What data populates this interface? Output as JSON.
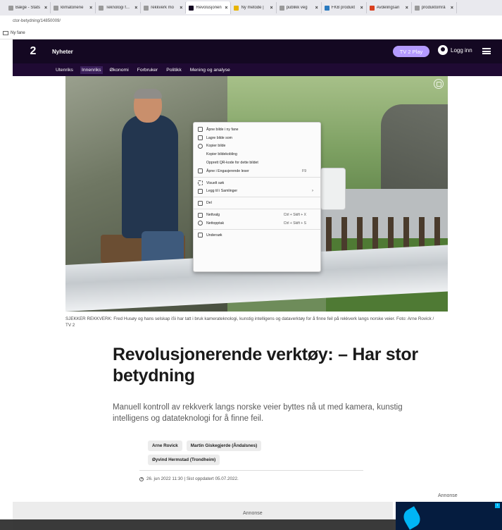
{
  "browser": {
    "tabs": [
      {
        "label": "Bæge - Stats"
      },
      {
        "label": "klimatoriene"
      },
      {
        "label": "Teknologi f..."
      },
      {
        "label": "rekkverk mo"
      },
      {
        "label": "Revolusjonen",
        "active": true
      },
      {
        "label": "Ny metode |"
      },
      {
        "label": "publikk veg"
      },
      {
        "label": "FKB produkt"
      },
      {
        "label": "Avdelingsan"
      },
      {
        "label": "produktområ"
      }
    ],
    "url": "ctor-betydning/14850009/",
    "bookmark": "Ny fane"
  },
  "header": {
    "logo": "2",
    "section": "Nyheter",
    "tv2play": "TV 2 Play",
    "login": "Logg inn"
  },
  "subnav": {
    "items": [
      {
        "label": "Utenriks"
      },
      {
        "label": "Innenriks",
        "active": true
      },
      {
        "label": "Økonomi"
      },
      {
        "label": "Forbruker"
      },
      {
        "label": "Politikk"
      },
      {
        "label": "Mening og analyse"
      }
    ]
  },
  "context_menu": {
    "items": [
      {
        "label": "Åpne bilde i ny fane",
        "icon": "open-image-icon"
      },
      {
        "label": "Lagre bilde som",
        "icon": "save-image-icon"
      },
      {
        "label": "Kopier bilde",
        "icon": "copy-image-icon"
      },
      {
        "label": "Kopier bildekobling",
        "icon": ""
      },
      {
        "label": "Opprett QR-kode for dette bildet",
        "icon": ""
      },
      {
        "label": "Åpne i Engasjerende leser",
        "icon": "immersive-reader-icon",
        "shortcut": "F9"
      },
      {
        "label": "Visuelt søk",
        "icon": "visual-search-icon"
      },
      {
        "label": "Legg til i Samlinger",
        "icon": "collections-icon",
        "submenu": true
      },
      {
        "label": "Del",
        "icon": "share-icon"
      },
      {
        "label": "Nettvalg",
        "icon": "web-select-icon",
        "shortcut": "Ctrl + Skift + X"
      },
      {
        "label": "Nettopptak",
        "icon": "web-capture-icon",
        "shortcut": "Ctrl + Skift + S"
      },
      {
        "label": "Undersøk",
        "icon": "inspect-icon"
      }
    ]
  },
  "article": {
    "caption": "SJEKKER REKKVERK: Fred Husøy og hans selskap iSi har tatt i bruk kamerateknologi, kunstig intelligens og dataverktøy for å finne feil på rekkverk langs norske veier. Foto: Arne Rovick / TV 2",
    "headline": "Revolusjonerende verktøy: – Har stor betydning",
    "lead": "Manuell kontroll av rekkverk langs norske veier byttes nå ut med kamera, kunstig intelligens og datateknologi for å finne feil.",
    "bylines": [
      "Arne Rovick",
      "Martin Giskegjerde (Åndalsnes)",
      "Øyvind Hermstad (Trondheim)"
    ],
    "dateline": "26. jun 2022 11:30 | Sist oppdatert 05.07.2022."
  },
  "ads": {
    "right_label": "Annonse",
    "banner_label": "Annonse"
  }
}
